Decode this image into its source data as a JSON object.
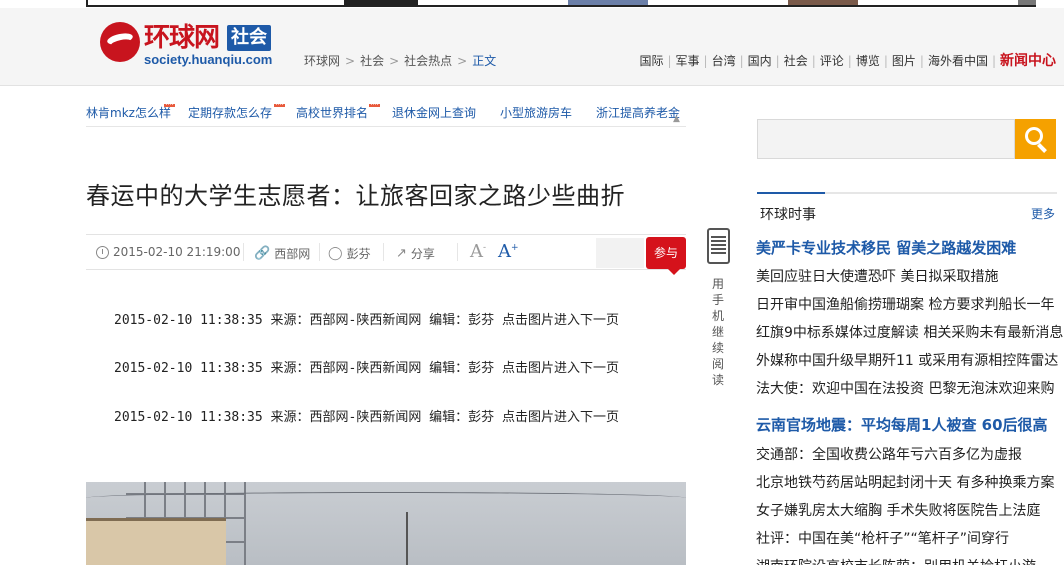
{
  "header": {
    "logo_name": "环球网",
    "logo_badge": "社会",
    "logo_domain": "society.huanqiu.com",
    "breadcrumb": [
      "环球网",
      "社会",
      "社会热点",
      "正文"
    ],
    "nav": [
      "国际",
      "军事",
      "台湾",
      "国内",
      "社会",
      "评论",
      "博览",
      "图片",
      "海外看中国"
    ],
    "news_center": "新闻中心"
  },
  "hot_keywords": [
    {
      "label": "林肯mkz怎么样",
      "hot": true
    },
    {
      "label": "定期存款怎么存",
      "hot": true
    },
    {
      "label": "高校世界排名",
      "hot": true
    },
    {
      "label": "退休金网上查询",
      "hot": false
    },
    {
      "label": "小型旅游房车",
      "hot": false
    },
    {
      "label": "浙江提高养老金",
      "hot": false
    }
  ],
  "hot_flag": "热",
  "article": {
    "title": "春运中的大学生志愿者：让旅客回家之路少些曲折",
    "datetime": "2015-02-10 21:19:00",
    "source": "西部网",
    "author": "彭芬",
    "share": "分享",
    "font_smaller": "A",
    "font_larger": "A",
    "comment": "参与",
    "qr_text": "用手机继续阅读",
    "paragraphs": [
      "2015-02-10 11:38:35 来源：西部网-陕西新闻网 编辑：彭芬 点击图片进入下一页",
      "2015-02-10 11:38:35 来源：西部网-陕西新闻网 编辑：彭芬 点击图片进入下一页",
      "2015-02-10 11:38:35 来源：西部网-陕西新闻网 编辑：彭芬 点击图片进入下一页"
    ]
  },
  "sidebar": {
    "search_placeholder": "",
    "section_title": "环球时事",
    "more": "更多",
    "items": [
      {
        "text": "美严卡专业技术移民 留美之路越发困难",
        "headline": true
      },
      {
        "text": "美回应驻日大使遭恐吓 美日拟采取措施",
        "headline": false
      },
      {
        "text": "日开审中国渔船偷捞珊瑚案 检方要求判船长一年",
        "headline": false
      },
      {
        "text": "红旗9中标系媒体过度解读 相关采购未有最新消息",
        "headline": false
      },
      {
        "text": "外媒称中国升级早期歼11 或采用有源相控阵雷达",
        "headline": false
      },
      {
        "text": "法大使：欢迎中国在法投资 巴黎无泡沫欢迎来购",
        "headline": false
      },
      {
        "text": "云南官场地震：平均每周1人被查 60后很高",
        "headline": true
      },
      {
        "text": "交通部：全国收费公路年亏六百多亿为虚报",
        "headline": false
      },
      {
        "text": "北京地铁芍药居站明起封闭十天 有多种换乘方案",
        "headline": false
      },
      {
        "text": "女子嫌乳房太大缩胸 手术失败将医院告上法庭",
        "headline": false
      },
      {
        "text": "社评：中国在美“枪杆子”“笔杆子”间穿行",
        "headline": false
      },
      {
        "text": "湖南环院设高校市长陈荫：别用机关捡杆小游",
        "headline": false
      }
    ]
  }
}
